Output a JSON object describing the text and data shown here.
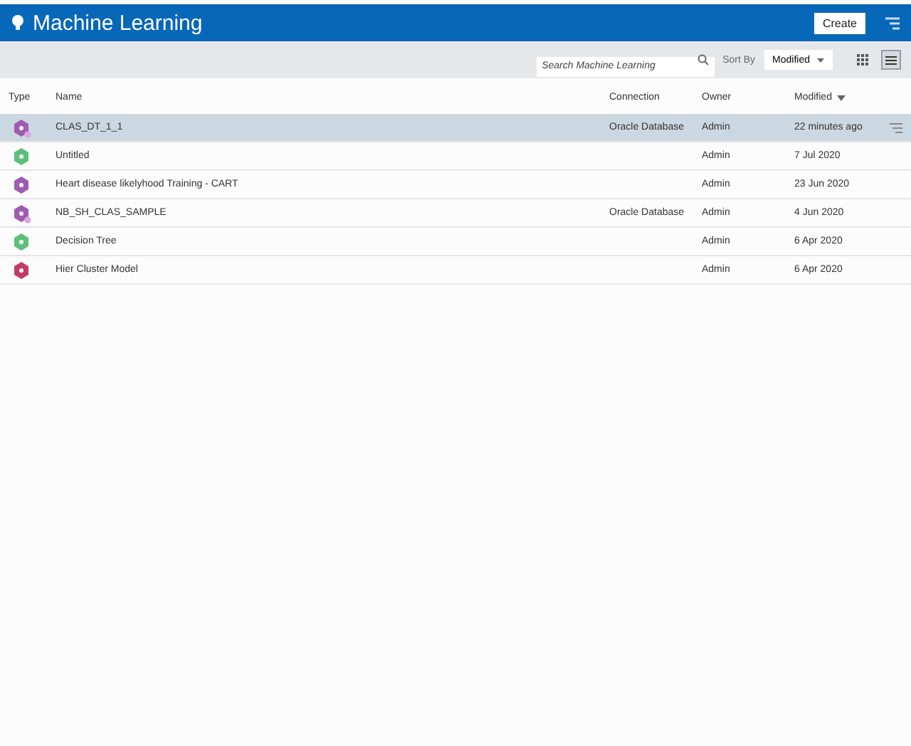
{
  "header": {
    "title": "Machine Learning",
    "create_button": "Create"
  },
  "toolbar": {
    "search": {
      "placeholder": "Search Machine Learning"
    },
    "sort_label": "Sort By",
    "sort_value": "Modified",
    "views": [
      {
        "kind": "grid",
        "selected": false
      },
      {
        "kind": "list",
        "selected": true
      }
    ]
  },
  "table": {
    "columns": [
      "Type",
      "Name",
      "Connection",
      "Owner",
      "Modified"
    ],
    "rows": [
      {
        "color": "#a05bb0",
        "badge": true,
        "name": "CLAS_DT_1_1",
        "connection": "Oracle Database",
        "owner": "Admin",
        "modified": "22 minutes ago",
        "selected": true
      },
      {
        "color": "#5dbf7a",
        "badge": false,
        "name": "Untitled",
        "owner": "Admin",
        "modified": "7 Jul 2020",
        "selected": false
      },
      {
        "color": "#a05bb0",
        "badge": false,
        "name": "Heart disease likelyhood Training - CART",
        "owner": "Admin",
        "modified": "23 Jun 2020",
        "selected": false
      },
      {
        "color": "#a05bb0",
        "badge": true,
        "name": "NB_SH_CLAS_SAMPLE",
        "connection": "Oracle Database",
        "owner": "Admin",
        "modified": "4 Jun 2020",
        "selected": false
      },
      {
        "color": "#5dbf7a",
        "badge": false,
        "name": "Decision Tree",
        "owner": "Admin",
        "modified": "6 Apr 2020",
        "selected": false
      },
      {
        "color": "#c43a68",
        "badge": false,
        "name": "Hier Cluster Model",
        "owner": "Admin",
        "modified": "6 Apr 2020",
        "selected": false
      }
    ]
  }
}
